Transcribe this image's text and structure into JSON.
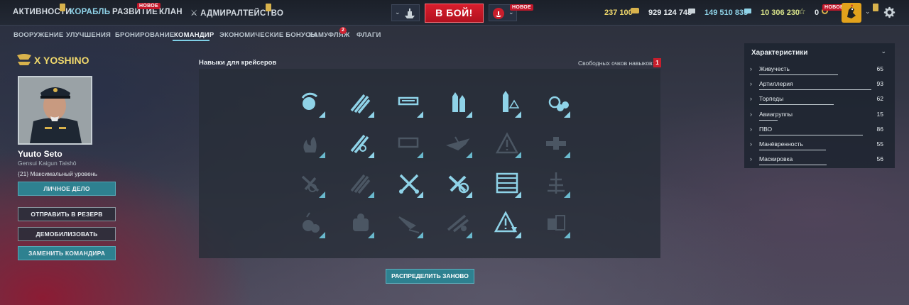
{
  "topbar": {
    "nav": [
      {
        "label": "АКТИВНОСТИ"
      },
      {
        "label": "КОРАБЛЬ"
      },
      {
        "label": "РАЗВИТИЕ"
      },
      {
        "label": "КЛАН"
      },
      {
        "label": "АДМИРАЛТЕЙСТВО"
      }
    ],
    "new_badge": "НОВОЕ",
    "battle_label": "В БОЙ!",
    "resources": {
      "doubloons": "237 100",
      "credits": "929 124 748",
      "free_xp": "149 510 835",
      "coal": "10 306 230",
      "other": "0"
    }
  },
  "subnav": [
    {
      "label": "ВООРУЖЕНИЕ"
    },
    {
      "label": "УЛУЧШЕНИЯ"
    },
    {
      "label": "БРОНИРОВАНИЕ"
    },
    {
      "label": "КОМАНДИР"
    },
    {
      "label": "ЭКОНОМИЧЕСКИЕ БОНУСЫ"
    },
    {
      "label": "КАМУФЛЯЖ"
    },
    {
      "label": "ФЛАГИ"
    }
  ],
  "subnav_badge": "2",
  "ship": {
    "tier_name": "X YOSHINO"
  },
  "commander": {
    "name": "Yuuto Seto",
    "rank": "Gensui Kaigun Taishō",
    "level_num": "21",
    "level_text": "Максимальный уровень"
  },
  "buttons": {
    "personal_file": "ЛИЧНОЕ ДЕЛО",
    "reserve": "ОТПРАВИТЬ В РЕЗЕРВ",
    "demobilize": "ДЕМОБИЛИЗОВАТЬ",
    "replace": "ЗАМЕНИТЬ КОМАНДИРА",
    "redistribute": "РАСПРЕДЕЛИТЬ ЗАНОВО"
  },
  "skills": {
    "title": "Навыки для крейсеров",
    "free_points_label": "Свободных очков навыков:",
    "free_points_value": "1",
    "grid": [
      [
        {
          "icon": "turret-rotation-icon",
          "active": true
        },
        {
          "icon": "torpedo-reload-icon",
          "active": true
        },
        {
          "icon": "gun-loader-icon",
          "active": true
        },
        {
          "icon": "shells-icon",
          "active": true
        },
        {
          "icon": "shell-warning-icon",
          "active": true
        },
        {
          "icon": "aa-gunner-icon",
          "active": true
        }
      ],
      [
        {
          "icon": "fire-icon",
          "active": false
        },
        {
          "icon": "torpedo-rotation-icon",
          "active": true
        },
        {
          "icon": "loader-faded-icon",
          "active": false
        },
        {
          "icon": "aircraft-icon",
          "active": false
        },
        {
          "icon": "warning-icon",
          "active": false
        },
        {
          "icon": "gun-faded-icon",
          "active": false
        }
      ],
      [
        {
          "icon": "repair-icon",
          "active": false
        },
        {
          "icon": "torpedoes-faded-icon",
          "active": false
        },
        {
          "icon": "crossed-swords-icon",
          "active": true
        },
        {
          "icon": "fight-tools-icon",
          "active": true
        },
        {
          "icon": "armor-plates-icon",
          "active": true
        },
        {
          "icon": "antenna-icon",
          "active": false
        }
      ],
      [
        {
          "icon": "bombs-icon",
          "active": false
        },
        {
          "icon": "turret-faded-icon",
          "active": false
        },
        {
          "icon": "arrow-faded-icon",
          "active": false
        },
        {
          "icon": "plane-repair-icon",
          "active": false
        },
        {
          "icon": "alert-down-icon",
          "active": true
        },
        {
          "icon": "engine-faded-icon",
          "active": false
        }
      ]
    ]
  },
  "characteristics": {
    "title": "Характеристики",
    "rows": [
      {
        "label": "Живучесть",
        "value": "65",
        "fill": 0.65
      },
      {
        "label": "Артиллерия",
        "value": "93",
        "fill": 0.93
      },
      {
        "label": "Торпеды",
        "value": "62",
        "fill": 0.62
      },
      {
        "label": "Авиагруппы",
        "value": "15",
        "fill": 0.15
      },
      {
        "label": "ПВО",
        "value": "86",
        "fill": 0.86
      },
      {
        "label": "Манёвренность",
        "value": "55",
        "fill": 0.55
      },
      {
        "label": "Маскировка",
        "value": "56",
        "fill": 0.56
      }
    ]
  },
  "colors": {
    "accent": "#7fd0e6",
    "battle": "#c81e2c",
    "skill_active": "#8fd3e8",
    "skill_inactive": "#4b5663",
    "gold": "#f0d86c"
  }
}
